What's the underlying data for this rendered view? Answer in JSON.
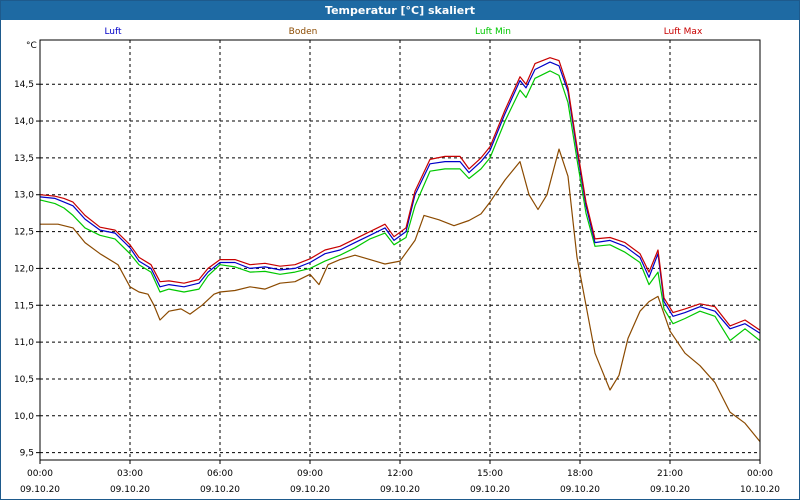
{
  "chart_data": {
    "type": "line",
    "title": "Temperatur [°C] skaliert",
    "ylabel": "°C",
    "ylim": [
      9.4,
      15.1
    ],
    "yticks": [
      9.5,
      10.0,
      10.5,
      11.0,
      11.5,
      12.0,
      12.5,
      13.0,
      13.5,
      14.0,
      14.5
    ],
    "ytick_labels": [
      "9,5",
      "10,0",
      "10,5",
      "11,0",
      "11,5",
      "12,0",
      "12,5",
      "13,0",
      "13,5",
      "14,0",
      "14,5"
    ],
    "xlim": [
      0,
      24
    ],
    "xticks": [
      0,
      3,
      6,
      9,
      12,
      15,
      18,
      21,
      24
    ],
    "xtick_labels": [
      [
        "00:00",
        "09.10.20"
      ],
      [
        "03:00",
        "09.10.20"
      ],
      [
        "06:00",
        "09.10.20"
      ],
      [
        "09:00",
        "09.10.20"
      ],
      [
        "12:00",
        "09.10.20"
      ],
      [
        "15:00",
        "09.10.20"
      ],
      [
        "18:00",
        "09.10.20"
      ],
      [
        "21:00",
        "09.10.20"
      ],
      [
        "00:00",
        "10.10.20"
      ]
    ],
    "grid": true,
    "legend_position": "top",
    "series": [
      {
        "name": "Luft",
        "color": "#0000c8",
        "points": [
          [
            0,
            12.97
          ],
          [
            0.5,
            12.95
          ],
          [
            0.8,
            12.9
          ],
          [
            1.1,
            12.85
          ],
          [
            1.5,
            12.67
          ],
          [
            2.0,
            12.52
          ],
          [
            2.5,
            12.48
          ],
          [
            3.0,
            12.28
          ],
          [
            3.3,
            12.1
          ],
          [
            3.7,
            12.0
          ],
          [
            4.0,
            11.75
          ],
          [
            4.3,
            11.78
          ],
          [
            4.8,
            11.75
          ],
          [
            5.3,
            11.8
          ],
          [
            5.6,
            11.95
          ],
          [
            6.0,
            12.08
          ],
          [
            6.5,
            12.08
          ],
          [
            7.0,
            12.0
          ],
          [
            7.5,
            12.02
          ],
          [
            8.0,
            11.98
          ],
          [
            8.5,
            12.0
          ],
          [
            9.0,
            12.08
          ],
          [
            9.5,
            12.2
          ],
          [
            10.0,
            12.25
          ],
          [
            10.5,
            12.35
          ],
          [
            11.0,
            12.45
          ],
          [
            11.5,
            12.55
          ],
          [
            11.8,
            12.38
          ],
          [
            12.2,
            12.5
          ],
          [
            12.5,
            13.0
          ],
          [
            13.0,
            13.42
          ],
          [
            13.5,
            13.45
          ],
          [
            14.0,
            13.45
          ],
          [
            14.3,
            13.3
          ],
          [
            14.7,
            13.45
          ],
          [
            15.0,
            13.6
          ],
          [
            15.5,
            14.1
          ],
          [
            16.0,
            14.55
          ],
          [
            16.2,
            14.45
          ],
          [
            16.5,
            14.7
          ],
          [
            17.0,
            14.8
          ],
          [
            17.3,
            14.75
          ],
          [
            17.6,
            14.4
          ],
          [
            17.9,
            13.6
          ],
          [
            18.2,
            12.85
          ],
          [
            18.5,
            12.35
          ],
          [
            19.0,
            12.38
          ],
          [
            19.5,
            12.3
          ],
          [
            20.0,
            12.15
          ],
          [
            20.3,
            11.88
          ],
          [
            20.6,
            12.2
          ],
          [
            20.8,
            11.55
          ],
          [
            21.1,
            11.35
          ],
          [
            21.5,
            11.4
          ],
          [
            22.0,
            11.48
          ],
          [
            22.5,
            11.42
          ],
          [
            23.0,
            11.18
          ],
          [
            23.5,
            11.25
          ],
          [
            24.0,
            11.12
          ]
        ]
      },
      {
        "name": "Boden",
        "color": "#8b4a00",
        "points": [
          [
            0,
            12.6
          ],
          [
            0.6,
            12.6
          ],
          [
            1.1,
            12.55
          ],
          [
            1.5,
            12.35
          ],
          [
            2.0,
            12.2
          ],
          [
            2.6,
            12.05
          ],
          [
            3.0,
            11.75
          ],
          [
            3.3,
            11.68
          ],
          [
            3.6,
            11.65
          ],
          [
            3.8,
            11.5
          ],
          [
            4.0,
            11.3
          ],
          [
            4.3,
            11.42
          ],
          [
            4.7,
            11.45
          ],
          [
            5.0,
            11.38
          ],
          [
            5.4,
            11.5
          ],
          [
            5.8,
            11.65
          ],
          [
            6.0,
            11.68
          ],
          [
            6.5,
            11.7
          ],
          [
            7.0,
            11.75
          ],
          [
            7.5,
            11.72
          ],
          [
            8.0,
            11.8
          ],
          [
            8.5,
            11.82
          ],
          [
            9.0,
            11.92
          ],
          [
            9.3,
            11.78
          ],
          [
            9.6,
            12.05
          ],
          [
            10.0,
            12.12
          ],
          [
            10.5,
            12.18
          ],
          [
            11.0,
            12.12
          ],
          [
            11.5,
            12.06
          ],
          [
            12.0,
            12.1
          ],
          [
            12.5,
            12.38
          ],
          [
            12.8,
            12.72
          ],
          [
            13.3,
            12.66
          ],
          [
            13.8,
            12.58
          ],
          [
            14.3,
            12.65
          ],
          [
            14.7,
            12.74
          ],
          [
            15.0,
            12.9
          ],
          [
            15.5,
            13.2
          ],
          [
            16.0,
            13.45
          ],
          [
            16.3,
            13.0
          ],
          [
            16.6,
            12.8
          ],
          [
            16.9,
            13.0
          ],
          [
            17.3,
            13.62
          ],
          [
            17.6,
            13.25
          ],
          [
            17.9,
            12.15
          ],
          [
            18.2,
            11.5
          ],
          [
            18.5,
            10.85
          ],
          [
            18.8,
            10.55
          ],
          [
            19.0,
            10.35
          ],
          [
            19.3,
            10.55
          ],
          [
            19.6,
            11.05
          ],
          [
            20.0,
            11.42
          ],
          [
            20.3,
            11.55
          ],
          [
            20.6,
            11.62
          ],
          [
            21.0,
            11.15
          ],
          [
            21.5,
            10.85
          ],
          [
            22.0,
            10.68
          ],
          [
            22.5,
            10.45
          ],
          [
            23.0,
            10.05
          ],
          [
            23.5,
            9.9
          ],
          [
            24.0,
            9.65
          ]
        ]
      },
      {
        "name": "Luft Min",
        "color": "#00c800",
        "points": [
          [
            0,
            12.93
          ],
          [
            0.5,
            12.88
          ],
          [
            0.8,
            12.82
          ],
          [
            1.1,
            12.72
          ],
          [
            1.5,
            12.55
          ],
          [
            2.0,
            12.45
          ],
          [
            2.5,
            12.4
          ],
          [
            3.0,
            12.2
          ],
          [
            3.3,
            12.05
          ],
          [
            3.7,
            11.95
          ],
          [
            4.0,
            11.68
          ],
          [
            4.3,
            11.72
          ],
          [
            4.8,
            11.68
          ],
          [
            5.3,
            11.72
          ],
          [
            5.6,
            11.9
          ],
          [
            6.0,
            12.05
          ],
          [
            6.5,
            12.02
          ],
          [
            7.0,
            11.95
          ],
          [
            7.5,
            11.96
          ],
          [
            8.0,
            11.92
          ],
          [
            8.5,
            11.95
          ],
          [
            9.0,
            12.0
          ],
          [
            9.5,
            12.1
          ],
          [
            10.0,
            12.18
          ],
          [
            10.5,
            12.28
          ],
          [
            11.0,
            12.4
          ],
          [
            11.5,
            12.48
          ],
          [
            11.8,
            12.32
          ],
          [
            12.2,
            12.42
          ],
          [
            12.5,
            12.85
          ],
          [
            13.0,
            13.32
          ],
          [
            13.5,
            13.35
          ],
          [
            14.0,
            13.35
          ],
          [
            14.3,
            13.22
          ],
          [
            14.7,
            13.35
          ],
          [
            15.0,
            13.5
          ],
          [
            15.5,
            14.0
          ],
          [
            16.0,
            14.42
          ],
          [
            16.2,
            14.32
          ],
          [
            16.5,
            14.58
          ],
          [
            17.0,
            14.68
          ],
          [
            17.3,
            14.62
          ],
          [
            17.6,
            14.25
          ],
          [
            17.9,
            13.48
          ],
          [
            18.2,
            12.75
          ],
          [
            18.5,
            12.3
          ],
          [
            19.0,
            12.32
          ],
          [
            19.5,
            12.22
          ],
          [
            20.0,
            12.08
          ],
          [
            20.3,
            11.78
          ],
          [
            20.6,
            11.95
          ],
          [
            20.8,
            11.45
          ],
          [
            21.1,
            11.25
          ],
          [
            21.5,
            11.32
          ],
          [
            22.0,
            11.42
          ],
          [
            22.5,
            11.35
          ],
          [
            23.0,
            11.02
          ],
          [
            23.5,
            11.18
          ],
          [
            24.0,
            11.02
          ]
        ]
      },
      {
        "name": "Luft Max",
        "color": "#c80000",
        "points": [
          [
            0,
            13.0
          ],
          [
            0.5,
            12.98
          ],
          [
            0.8,
            12.95
          ],
          [
            1.1,
            12.9
          ],
          [
            1.5,
            12.72
          ],
          [
            2.0,
            12.56
          ],
          [
            2.5,
            12.52
          ],
          [
            3.0,
            12.32
          ],
          [
            3.3,
            12.15
          ],
          [
            3.7,
            12.05
          ],
          [
            4.0,
            11.82
          ],
          [
            4.3,
            11.83
          ],
          [
            4.8,
            11.8
          ],
          [
            5.3,
            11.85
          ],
          [
            5.6,
            12.0
          ],
          [
            6.0,
            12.12
          ],
          [
            6.5,
            12.12
          ],
          [
            7.0,
            12.05
          ],
          [
            7.5,
            12.07
          ],
          [
            8.0,
            12.03
          ],
          [
            8.5,
            12.05
          ],
          [
            9.0,
            12.13
          ],
          [
            9.5,
            12.25
          ],
          [
            10.0,
            12.3
          ],
          [
            10.5,
            12.4
          ],
          [
            11.0,
            12.5
          ],
          [
            11.5,
            12.6
          ],
          [
            11.8,
            12.43
          ],
          [
            12.2,
            12.55
          ],
          [
            12.5,
            13.05
          ],
          [
            13.0,
            13.48
          ],
          [
            13.5,
            13.52
          ],
          [
            14.0,
            13.52
          ],
          [
            14.3,
            13.35
          ],
          [
            14.7,
            13.5
          ],
          [
            15.0,
            13.65
          ],
          [
            15.5,
            14.15
          ],
          [
            16.0,
            14.6
          ],
          [
            16.2,
            14.5
          ],
          [
            16.5,
            14.78
          ],
          [
            17.0,
            14.86
          ],
          [
            17.3,
            14.82
          ],
          [
            17.6,
            14.45
          ],
          [
            17.9,
            13.65
          ],
          [
            18.2,
            12.9
          ],
          [
            18.5,
            12.4
          ],
          [
            19.0,
            12.42
          ],
          [
            19.5,
            12.35
          ],
          [
            20.0,
            12.2
          ],
          [
            20.3,
            11.95
          ],
          [
            20.6,
            12.25
          ],
          [
            20.8,
            11.6
          ],
          [
            21.1,
            11.4
          ],
          [
            21.5,
            11.45
          ],
          [
            22.0,
            11.52
          ],
          [
            22.5,
            11.48
          ],
          [
            23.0,
            11.22
          ],
          [
            23.5,
            11.3
          ],
          [
            24.0,
            11.16
          ]
        ]
      }
    ]
  }
}
